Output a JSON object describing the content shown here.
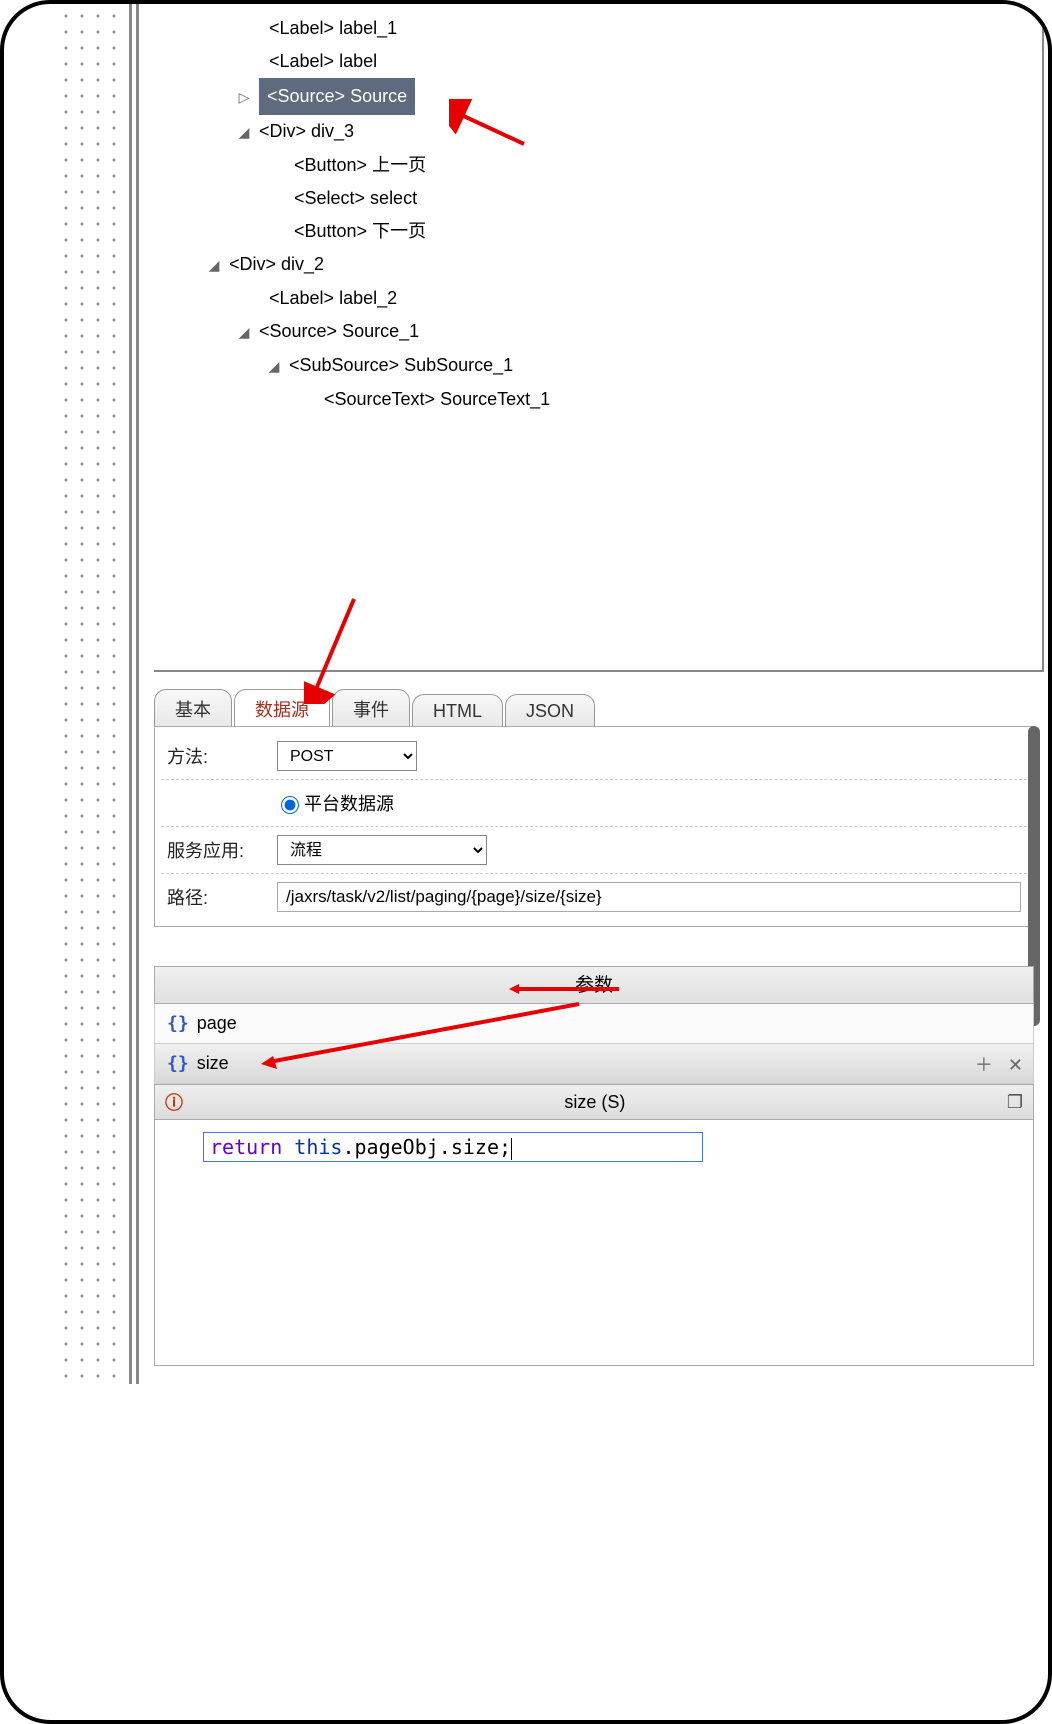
{
  "tree": {
    "n0": "<Label> label_1",
    "n1": "<Label> label",
    "n2": "<Source> Source",
    "n3": "<Div> div_3",
    "n4": "<Button> 上一页",
    "n5": "<Select> select",
    "n6": "<Button> 下一页",
    "n7": "<Div> div_2",
    "n8": "<Label> label_2",
    "n9": "<Source> Source_1",
    "n10": "<SubSource> SubSource_1",
    "n11": "<SourceText> SourceText_1"
  },
  "tabs": {
    "basic": "基本",
    "datasource": "数据源",
    "events": "事件",
    "html": "HTML",
    "json": "JSON"
  },
  "form": {
    "method_label": "方法:",
    "method_value": "POST",
    "platform_radio_label": "平台数据源",
    "service_app_label": "服务应用:",
    "service_app_value": "流程",
    "path_label": "路径:",
    "path_value": "/jaxrs/task/v2/list/paging/{page}/size/{size}"
  },
  "params": {
    "header": "参数",
    "p0": "page",
    "p1": "size"
  },
  "code": {
    "title": "size (S)",
    "kw_return": "return ",
    "kw_this": "this",
    "expr": ".pageObj.size;"
  }
}
